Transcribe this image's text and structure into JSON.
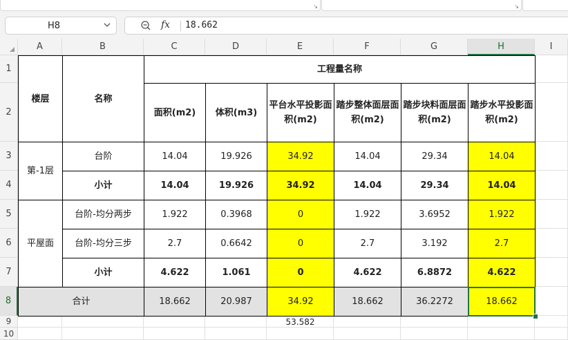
{
  "formula_bar": {
    "name_box": "H8",
    "fx_label": "fx",
    "formula_value": "18.662"
  },
  "icons": {
    "dropdown": "chevron-down-icon",
    "zoom": "zoom-icon",
    "fx": "function-icon"
  },
  "columns": [
    "A",
    "B",
    "C",
    "D",
    "E",
    "F",
    "G",
    "H",
    "I"
  ],
  "rows": [
    "1",
    "2",
    "3",
    "4",
    "5",
    "6",
    "7",
    "8",
    "9",
    "10"
  ],
  "selected_cell": "H8",
  "colors": {
    "highlight": "#ffff00",
    "total_row": "#e2e2e2",
    "selection": "#217346"
  },
  "table": {
    "h_floor": "楼层",
    "h_name": "名称",
    "h_group": "工程量名称",
    "h_c": "面积(m2)",
    "h_d": "体积(m3)",
    "h_e": "平台水平投影面积(m2)",
    "h_f": "踏步整体面层面积(m2)",
    "h_g": "踏步块料面层面积(m2)",
    "h_h": "踏步水平投影面积(m2)",
    "floor1": "第-1层",
    "floor2": "平屋面",
    "total_label": "合计",
    "r3": {
      "b": "台阶",
      "c": "14.04",
      "d": "19.926",
      "e": "34.92",
      "f": "14.04",
      "g": "29.34",
      "h": "14.04"
    },
    "r4": {
      "b": "小计",
      "c": "14.04",
      "d": "19.926",
      "e": "34.92",
      "f": "14.04",
      "g": "29.34",
      "h": "14.04"
    },
    "r5": {
      "b": "台阶-均分两步",
      "c": "1.922",
      "d": "0.3968",
      "e": "0",
      "f": "1.922",
      "g": "3.6952",
      "h": "1.922"
    },
    "r6": {
      "b": "台阶-均分三步",
      "c": "2.7",
      "d": "0.6642",
      "e": "0",
      "f": "2.7",
      "g": "3.192",
      "h": "2.7"
    },
    "r7": {
      "b": "小计",
      "c": "4.622",
      "d": "1.061",
      "e": "0",
      "f": "4.622",
      "g": "6.8872",
      "h": "4.622"
    },
    "r8": {
      "c": "18.662",
      "d": "20.987",
      "e": "34.92",
      "f": "18.662",
      "g": "36.2272",
      "h": "18.662"
    },
    "e9": "53.582"
  }
}
